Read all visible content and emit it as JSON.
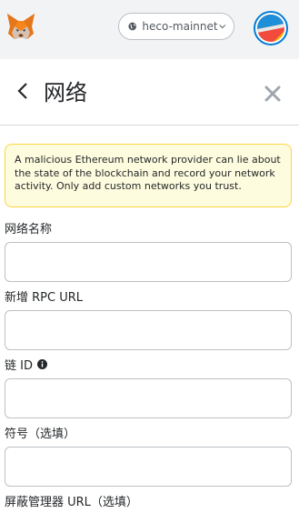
{
  "header": {
    "network_name": "heco-mainnet"
  },
  "page": {
    "title": "网络"
  },
  "warning": {
    "text": "A malicious Ethereum network provider can lie about the state of the blockchain and record your network activity. Only add custom networks you trust."
  },
  "form": {
    "network_name_label": "网络名称",
    "network_name_value": "",
    "rpc_url_label": "新增 RPC URL",
    "rpc_url_value": "",
    "chain_id_label": "链 ID",
    "chain_id_value": "",
    "symbol_label": "符号（选填）",
    "symbol_value": "",
    "explorer_url_label": "屏蔽管理器 URL（选填）"
  },
  "colors": {
    "topbar_bg": "#f2f3f4",
    "warning_border": "#ffd33d",
    "warning_bg": "#fefcde",
    "avatar_ring": "#037dd6"
  },
  "icons": {
    "logo": "metamask-fox-icon",
    "network": "globe-icon",
    "dropdown": "chevron-down-icon",
    "back": "chevron-left-icon",
    "close": "close-icon",
    "info": "info-icon"
  }
}
